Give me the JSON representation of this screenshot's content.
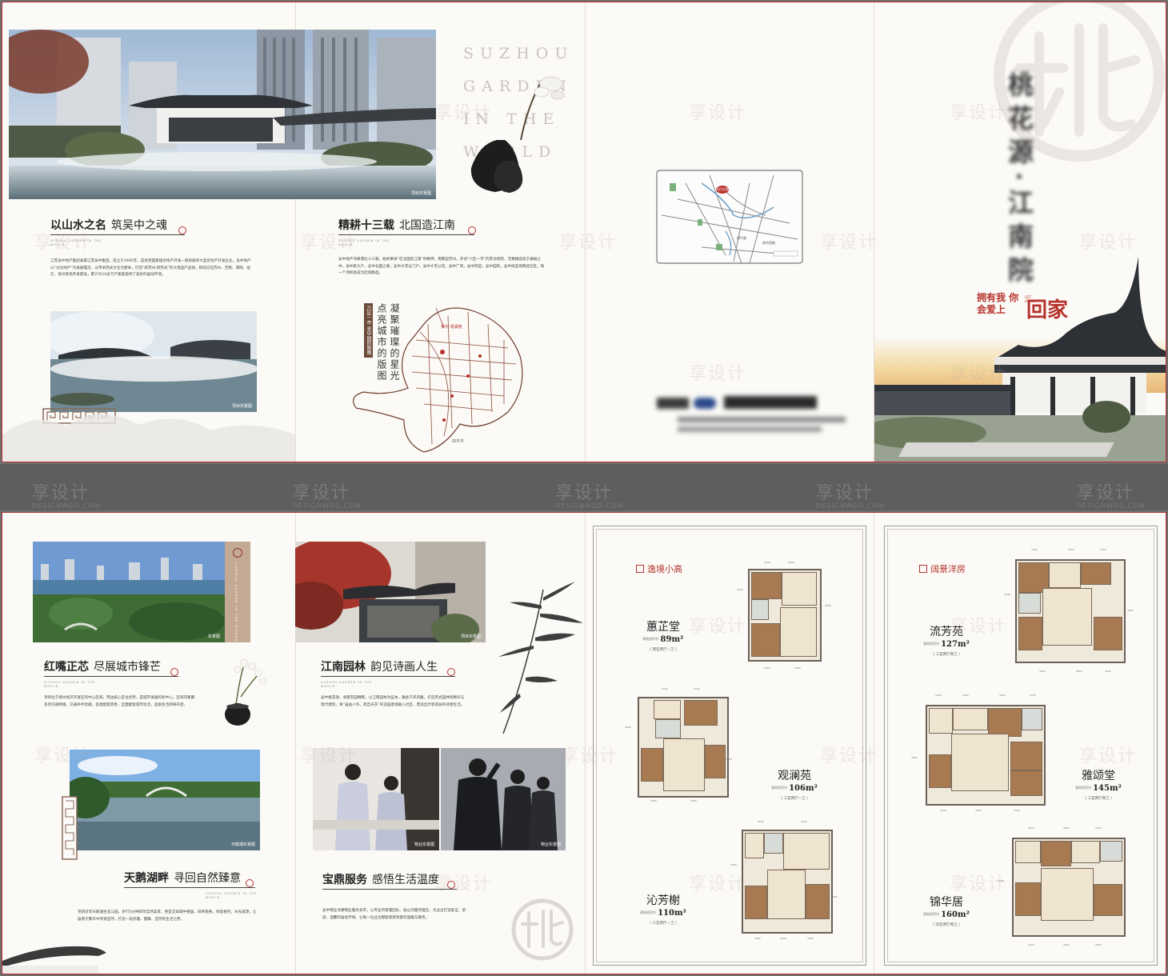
{
  "top": {
    "p1": {
      "photo_caption": "项目实景图",
      "heading": "以山水之名",
      "heading_sub": "筑吴中之魂",
      "tagline": "SUZHOU GARDEN IN THE WORLD",
      "body": "江苏吴中地产集团隶属江苏吴中集团，成立于1992年，是具有国家级房地产开发一级资质的大型房地产开发企业。吴中地产以“文化地产”为发展理念，以传承苏式文化为使命，打造“新苏州·新苏式”的大境品产品线，目前已在苏州、无锡、泗阳、宿迁、常州等地开发建设，累计为10多万户家庭提供了美好的居住环境。",
      "photo2_caption": "项目实景图"
    },
    "p2": {
      "english": [
        "SUZHOU",
        "GARDEN",
        "IN THE",
        "WORLD"
      ],
      "heading": "精耕十三载",
      "heading_sub": "北国造江南",
      "tagline": "SUZHOU GARDEN IN THE WORLD",
      "body": "吴中地产深耕泗北十三载，始终秉承“在北国造江南”的精神，用典型苏州，开创“六区一市”的苏派新院，无数精品筑于桑榆之中，吴中家大户，吴中北国之春，吴中大宅业门户，吴中大宅公馆，吴中广场，吴中院是，吴中园筑，吴中尚品等精选社区，每一个项目皆成为区域精品。",
      "vertical_a": "凝聚璀璨的星光",
      "vertical_b": "点亮城市的版图",
      "city_tag": "六区一市 吴中园的版图",
      "map_labels": [
        "吴中·观澜苑",
        "四平市"
      ]
    },
    "p3": {
      "map_labels": [
        "项目位置",
        "花园南路",
        "湖滨路",
        "天鹅湖",
        "四平路",
        "南京西路",
        "人民路"
      ],
      "contact_blurred": "0000-0000000"
    },
    "p4": {
      "logo_char": "桃",
      "title_vertical": "桃花源·江南院",
      "slogan_small": "拥有我 你会爱上",
      "slogan_big": "回家",
      "slogan_en": "GET HOME"
    },
    "watermark": "享设计"
  },
  "band": {
    "watermark": "享设计",
    "watermark_en": "DESIGNWDD.COM"
  },
  "bottom": {
    "p5": {
      "photo1_caption": "实景图",
      "side_label": "SUZHOU GARDEN IN THE WORLD",
      "heading": "红嘴正芯",
      "heading_sub": "尽展城市锋芒",
      "tagline": "SUZHOU GARDEN IN THE WORLD",
      "body": "项目位于扬州经济开发区的中心区域，周边核心区位优势，是城市发展的新中心，区域内集聚多项交通网络，交通条件优越，各类配套完善，全面配套城市生活，品质生活即将开启。",
      "photo2_caption": "天鹅湖实景图",
      "heading2": "天鹅湖畔",
      "heading2_sub": "寻回自然臻意",
      "body2": "项目近享天鹅湖生态公园，步行5分钟即享自然美景，更是这如城中栖居，四季变换，绿意盎然，水光潋滟，让居者于繁华中享受自然，打造一处优雅、健康、自然的生活之所。"
    },
    "p6": {
      "photo1_caption": "项目实景图",
      "heading": "江南园林",
      "heading_sub": "韵见诗画人生",
      "tagline": "SUZHOU GARDEN IN THE WORLD",
      "body": "吴中桃花源，承袭苏园精粹，以江南园林为蓝本，融会千年风雅，打造苏式园林的精华与现代建筑，将“虽由人作，宛自天开”的造园意境融入社区，营造出步移景异的诗意生活。",
      "photo2_caption": "物业实景图",
      "photo3_caption": "物业实景图",
      "heading2": "宝鼎服务",
      "heading2_sub": "感悟生活温度",
      "body2": "吴中物业深耕物业服务多年，以专业的管理团队、贴心的服务理念，为业主打造安全、舒适、温馨的居住环境，让每一位业主都能感受到家的温暖与尊贵。"
    },
    "p7": {
      "section_title": "逸境小高",
      "units": [
        {
          "name": "蕙芷堂",
          "area": "89m²",
          "area_label": "建筑面积约",
          "type": "[ 两室两厅一卫 ]"
        },
        {
          "name": "观澜苑",
          "area": "106m²",
          "area_label": "建筑面积约",
          "type": "[ 三室两厅一卫 ]"
        },
        {
          "name": "沁芳榭",
          "area": "110m²",
          "area_label": "建筑面积约",
          "type": "[ 三室两厅一卫 ]"
        }
      ]
    },
    "p8": {
      "section_title": "阔景洋房",
      "units": [
        {
          "name": "流芳苑",
          "area": "127m²",
          "area_label": "建筑面积约",
          "type": "[ 三室两厅两卫 ]"
        },
        {
          "name": "雅颂堂",
          "area": "145m²",
          "area_label": "建筑面积约",
          "type": "[ 三室两厅两卫 ]"
        },
        {
          "name": "锦华居",
          "area": "160m²",
          "area_label": "建筑面积约",
          "type": "[ 四室两厅两卫 ]"
        }
      ]
    },
    "watermark": "享设计"
  },
  "colors": {
    "accent": "#b6312c",
    "paper": "#fbfaf7",
    "ink": "#222222",
    "band": "#5e5e5e"
  }
}
